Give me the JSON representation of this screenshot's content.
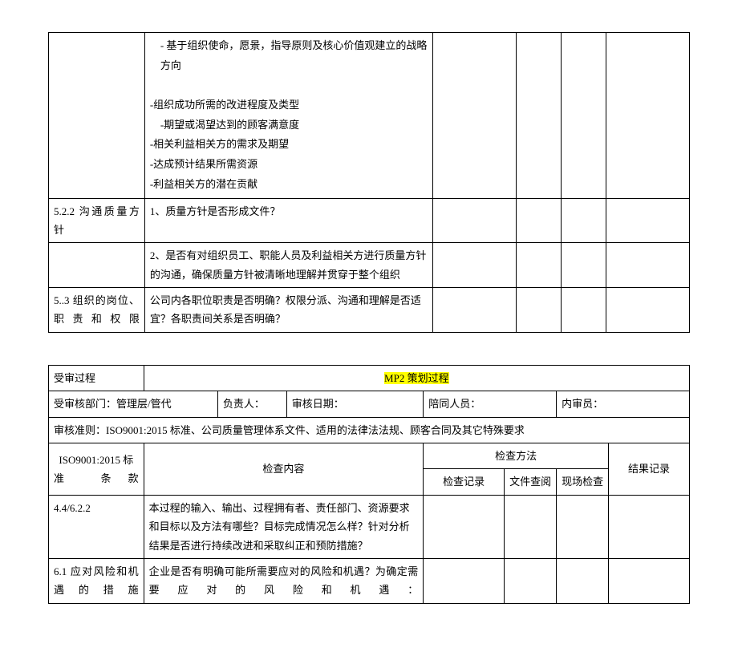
{
  "table1": {
    "row1": {
      "col1": "",
      "col2_line1": "- 基于组织使命，愿景，指导原则及核心价值观建立的战略方向",
      "col2_line2": "-组织成功所需的改进程度及类型",
      "col2_line3": "-期望或渴望达到的顾客满意度",
      "col2_line4": "-相关利益相关方的需求及期望",
      "col2_line5": "-达成预计结果所需资源",
      "col2_line6": "-利益相关方的潜在贡献"
    },
    "row2": {
      "col1": "5.2.2 沟通质量方针",
      "col2": "1、质量方针是否形成文件？"
    },
    "row3": {
      "col1": "",
      "col2": "2、是否有对组织员工、职能人员及利益相关方进行质量方针的沟通，确保质量方针被清晰地理解并贯穿于整个组织"
    },
    "row4": {
      "col1": "5..3 组织的岗位、职责和权限",
      "col2": "公司内各职位职责是否明确？权限分派、沟通和理解是否适宜？各职责间关系是否明确？"
    }
  },
  "table2": {
    "header": {
      "process_label": "受审过程",
      "process_value": "MP2 策划过程",
      "dept_label": "受审核部门：",
      "dept_value": "管理层/管代",
      "leader_label": "负责人：",
      "date_label": "审核日期：",
      "accomp_label": "陪同人员：",
      "auditor_label": "内审员：",
      "criteria_label": "审核准则：",
      "criteria_value": "ISO9001:2015 标准、公司质量管理体系文件、适用的法律法法规、顾客合同及其它特殊要求",
      "std_label": "ISO9001:2015 标准 条款",
      "check_content": "检查内容",
      "check_method": "检查方法",
      "record_check": "检查记录",
      "file_review": "文件查阅",
      "site_check": "现场检查",
      "result_label": "结果记录"
    },
    "rows": [
      {
        "clause": "4.4/6.2.2",
        "content": "本过程的输入、输出、过程拥有者、责任部门、资源要求和目标以及方法有哪些？目标完成情况怎么样？针对分析结果是否进行持续改进和采取纠正和预防措施？"
      },
      {
        "clause": "6.1 应对风险和机遇的措施",
        "content": "企业是否有明确可能所需要应对的风险和机遇？为确定需要应对的风险和机遇："
      }
    ]
  }
}
